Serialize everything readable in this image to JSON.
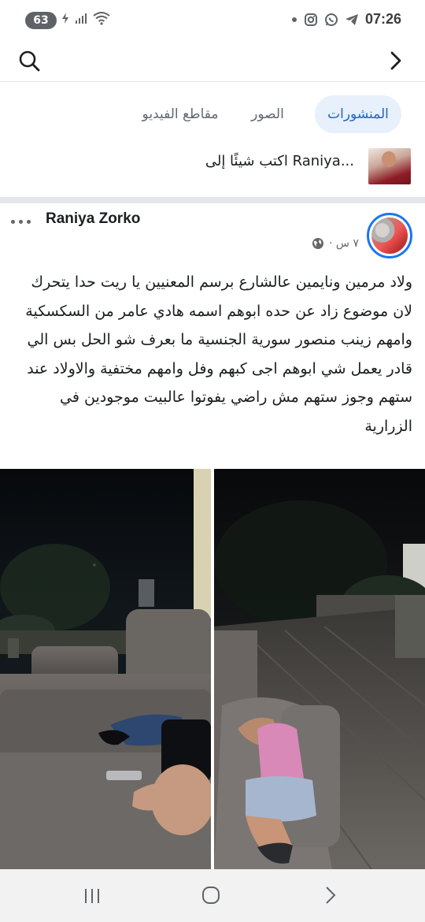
{
  "status_bar": {
    "battery": "63",
    "time": "07:26",
    "icons": [
      "battery-saver-icon",
      "signal-icon",
      "wifi-icon",
      "dot-icon",
      "instagram-icon",
      "whatsapp-icon",
      "telegram-icon"
    ]
  },
  "top_nav": {
    "search_icon": "search-icon",
    "forward_icon": "chevron-right-icon"
  },
  "tabs": {
    "posts": "المنشورات",
    "photos": "الصور",
    "videos": "مقاطع الفيديو",
    "active": "posts",
    "active_color": "#1e66c8",
    "active_bg": "#e7f0fb"
  },
  "composer": {
    "placeholder": "اكتب شيئًا إلى Raniya..."
  },
  "post": {
    "author": "Raniya Zorko",
    "time": "٧ س ·",
    "privacy_icon": "globe-icon",
    "text_lines": [
      "ولاد مرمين ونايمين عالشارع  برسم المعنيين يا ريت حدا يتحرك",
      "لان موضوع زاد عن حده ابوهم اسمه هادي عامر من السكسكية",
      "وامهم زينب منصور  سورية الجنسية ما بعرف شو الحل بس الي",
      "قادر يعمل شي ابوهم اجى كبهم وفل وامهم مختفية والاولاد عند",
      "ستهم   وجوز ستهم مش راضي يفوتوا عالبيت      موجودين في",
      "الزرارية"
    ],
    "photos": [
      "photo-children-sleeping-on-sofa-left",
      "photo-child-sleeping-on-sofa-right"
    ],
    "accent_color": "#1877f2"
  },
  "bottom_nav": {
    "icons": [
      "recents-icon",
      "home-icon",
      "back-icon"
    ]
  }
}
